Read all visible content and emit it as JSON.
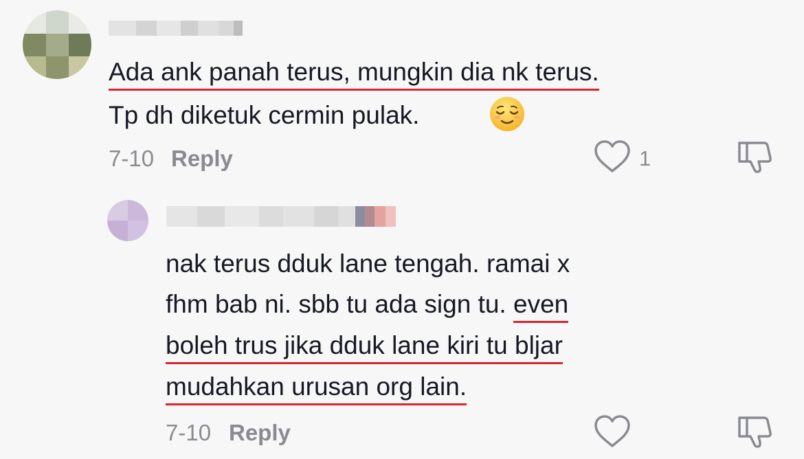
{
  "comments": [
    {
      "line1": "Ada ank panah terus, mungkin dia nk terus.",
      "line2": "Tp dh diketuk cermin pulak.",
      "emoji": "relieved-face",
      "date": "7-10",
      "reply_label": "Reply",
      "like_count": "1"
    },
    {
      "line1": "nak terus dduk lane tengah. ramai x",
      "line2_plain": "fhm bab ni. sbb tu ada sign tu. ",
      "line2_marked": "even",
      "line3": "boleh trus jika dduk lane kiri tu bljar",
      "line4": "mudahkan urusan org lain.",
      "date": "7-10",
      "reply_label": "Reply"
    }
  ],
  "colors": {
    "underline": "#d9242f",
    "meta": "#8a8b91",
    "text": "#161823"
  }
}
